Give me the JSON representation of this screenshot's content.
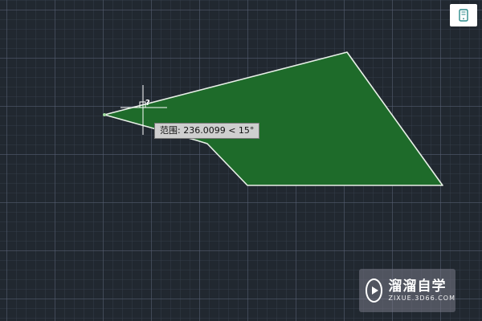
{
  "canvas": {
    "background_color": "#212830",
    "grid": true
  },
  "drawing": {
    "fill_color": "#1e6b2a",
    "outline_color": "#e8f0e8",
    "cursor_color": "#ffffff"
  },
  "cursor": {
    "marker": "?"
  },
  "tooltip": {
    "label": "范围:",
    "value": "236.0099",
    "angle": "< 15°"
  },
  "viewcube": {
    "icon": "tablet-icon"
  },
  "watermark": {
    "title": "溜溜自学",
    "url": "ZIXUE.3D66.COM",
    "icon": "play-icon"
  }
}
